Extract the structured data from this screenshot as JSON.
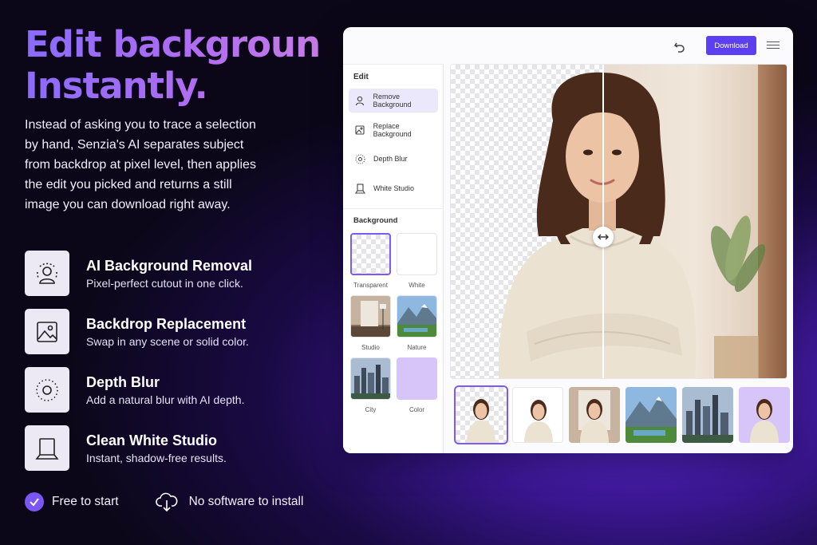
{
  "hero": {
    "headline_line1": "Edit backgrounds.",
    "headline_line2": "Instantly.",
    "description": "Instead of asking you to trace a selection by hand, Senzia's AI separates subject from backdrop at pixel level, then applies the edit you picked and returns a still image you can download right away."
  },
  "features": [
    {
      "title": "AI Background Removal",
      "subtitle": "Pixel-perfect cutout in one click.",
      "icon": "person-scan-icon"
    },
    {
      "title": "Backdrop Replacement",
      "subtitle": "Swap in any scene or solid color.",
      "icon": "image-icon"
    },
    {
      "title": "Depth Blur",
      "subtitle": "Add a natural blur with AI depth.",
      "icon": "blur-circle-icon"
    },
    {
      "title": "Clean White Studio",
      "subtitle": "Instant, shadow-free results.",
      "icon": "studio-icon"
    }
  ],
  "badges": {
    "free": "Free to start",
    "no_install": "No software to install"
  },
  "app": {
    "download_label": "Download",
    "edit_section": "Edit",
    "tools": [
      {
        "label": "Remove Background",
        "active": true
      },
      {
        "label": "Replace Background",
        "active": false
      },
      {
        "label": "Depth Blur",
        "active": false
      },
      {
        "label": "White Studio",
        "active": false
      }
    ],
    "background_section": "Background",
    "backgrounds": [
      {
        "label": "Transparent",
        "selected": true
      },
      {
        "label": "White",
        "selected": false
      },
      {
        "label": "Studio",
        "selected": false
      },
      {
        "label": "Nature",
        "selected": false
      },
      {
        "label": "City",
        "selected": false
      },
      {
        "label": "Color",
        "selected": false
      }
    ],
    "thumbnails": [
      "transparent",
      "white",
      "studio",
      "mountain",
      "city",
      "lavender"
    ]
  },
  "colors": {
    "accent": "#5b3ff0",
    "selection": "#7e5af5",
    "lavender": "#d7c4f8"
  }
}
